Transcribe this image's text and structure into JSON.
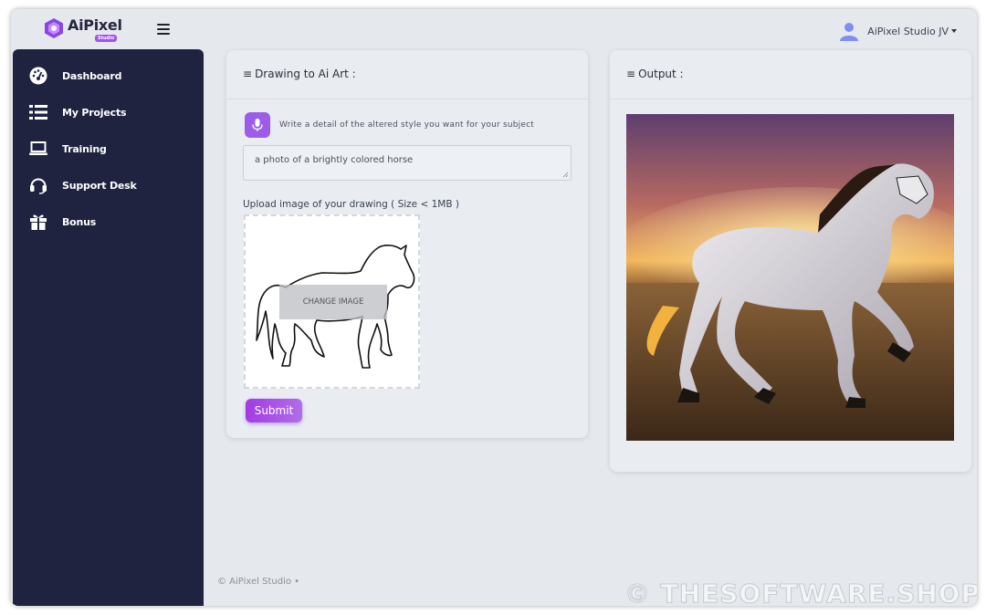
{
  "brand": {
    "name": "AiPixel",
    "badge": "Studio"
  },
  "header": {
    "user_name": "AiPixel Studio JV"
  },
  "sidebar": {
    "items": [
      {
        "label": "Dashboard",
        "icon": "dashboard-icon"
      },
      {
        "label": "My Projects",
        "icon": "list-icon"
      },
      {
        "label": "Training",
        "icon": "laptop-icon"
      },
      {
        "label": "Support Desk",
        "icon": "headset-icon"
      },
      {
        "label": "Bonus",
        "icon": "gift-icon"
      }
    ]
  },
  "drawing_card": {
    "title": "Drawing to Ai Art :",
    "hint": "Write a detail of the altered style you want for your subject",
    "prompt_value": "a photo of a brightly colored horse",
    "upload_label": "Upload image of your drawing ( Size < 1MB )",
    "change_image": "CHANGE IMAGE",
    "submit": "Submit"
  },
  "output_card": {
    "title": "Output :"
  },
  "footer": {
    "text": "© AiPixel Studio  •"
  },
  "watermark": "© THESOFTWARE.SHOP",
  "colors": {
    "sidebar_bg": "#1f2340",
    "accent": "#a453ef",
    "page_bg": "#e5e9ee"
  }
}
